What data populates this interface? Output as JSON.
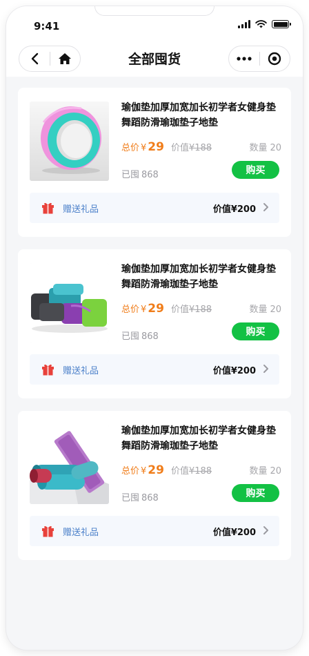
{
  "status_bar": {
    "time": "9:41"
  },
  "nav": {
    "title": "全部囤货"
  },
  "products": [
    {
      "title": "瑜伽垫加厚加宽加长初学者女健身垫舞蹈防滑瑜珈垫子地垫",
      "price_label": "总价",
      "currency": "¥",
      "price": "29",
      "orig_label": "价值",
      "orig_price": "¥188",
      "qty_label": "数量",
      "qty": "20",
      "sold_label": "已囤",
      "sold": "868",
      "buy_label": "购买",
      "gift_label": "赠送礼品",
      "gift_value": "价值¥200",
      "image": "yoga-wheel"
    },
    {
      "title": "瑜伽垫加厚加宽加长初学者女健身垫舞蹈防滑瑜珈垫子地垫",
      "price_label": "总价",
      "currency": "¥",
      "price": "29",
      "orig_label": "价值",
      "orig_price": "¥188",
      "qty_label": "数量",
      "qty": "20",
      "sold_label": "已囤",
      "sold": "868",
      "buy_label": "购买",
      "gift_label": "赠送礼品",
      "gift_value": "价值¥200",
      "image": "folded-mats"
    },
    {
      "title": "瑜伽垫加厚加宽加长初学者女健身垫舞蹈防滑瑜珈垫子地垫",
      "price_label": "总价",
      "currency": "¥",
      "price": "29",
      "orig_label": "价值",
      "orig_price": "¥188",
      "qty_label": "数量",
      "qty": "20",
      "sold_label": "已囤",
      "sold": "868",
      "buy_label": "购买",
      "gift_label": "赠送礼品",
      "gift_value": "价值¥200",
      "image": "rolled-mats"
    }
  ],
  "colors": {
    "accent_orange": "#f07d1a",
    "buy_green": "#13c144",
    "gift_blue": "#4a7fc9"
  }
}
